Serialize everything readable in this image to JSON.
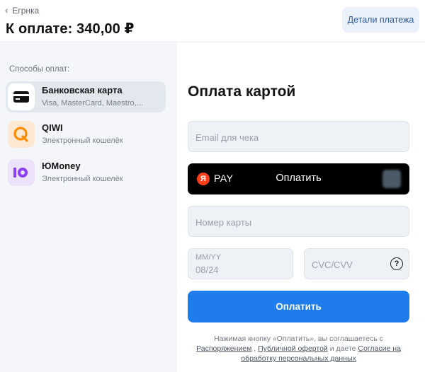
{
  "header": {
    "back_label": "Егрнка",
    "amount_label": "К оплате: 340,00 ₽",
    "details_button": "Детали платежа"
  },
  "sidebar": {
    "title": "Способы оплат:",
    "methods": [
      {
        "name": "Банковская карта",
        "sub": "Visa, MasterCard, Maestro,...",
        "icon": "credit-card-icon",
        "active": true
      },
      {
        "name": "QIWI",
        "sub": "Электронный кошелёк",
        "icon": "qiwi-icon",
        "active": false
      },
      {
        "name": "ЮMoney",
        "sub": "Электронный кошелёк",
        "icon": "yumoney-icon",
        "active": false
      }
    ]
  },
  "form": {
    "title": "Оплата картой",
    "email_placeholder": "Email для чека",
    "yandex_pay": {
      "logo": "Я",
      "brand": "PAY",
      "label": "Оплатить"
    },
    "card_number_placeholder": "Номер карты",
    "expiry_label": "MM/YY",
    "expiry_value": "08/24",
    "cvc_placeholder": "CVC/CVV",
    "help_glyph": "?",
    "pay_button": "Оплатить",
    "legal": {
      "line_prefix": "Нажимая кнопку «Оплатить», вы соглашаетесь с ",
      "link1": "Распоряжением",
      "sep1": " , ",
      "link2": "Публичной офертой",
      "sep2": " и даете ",
      "link3": "Согласие на обработку персональных данных"
    }
  },
  "colors": {
    "accent": "#1f7cec",
    "qiwi": "#ff8c00",
    "yumoney": "#8b3ffd",
    "yandex": "#fc3f1d"
  }
}
